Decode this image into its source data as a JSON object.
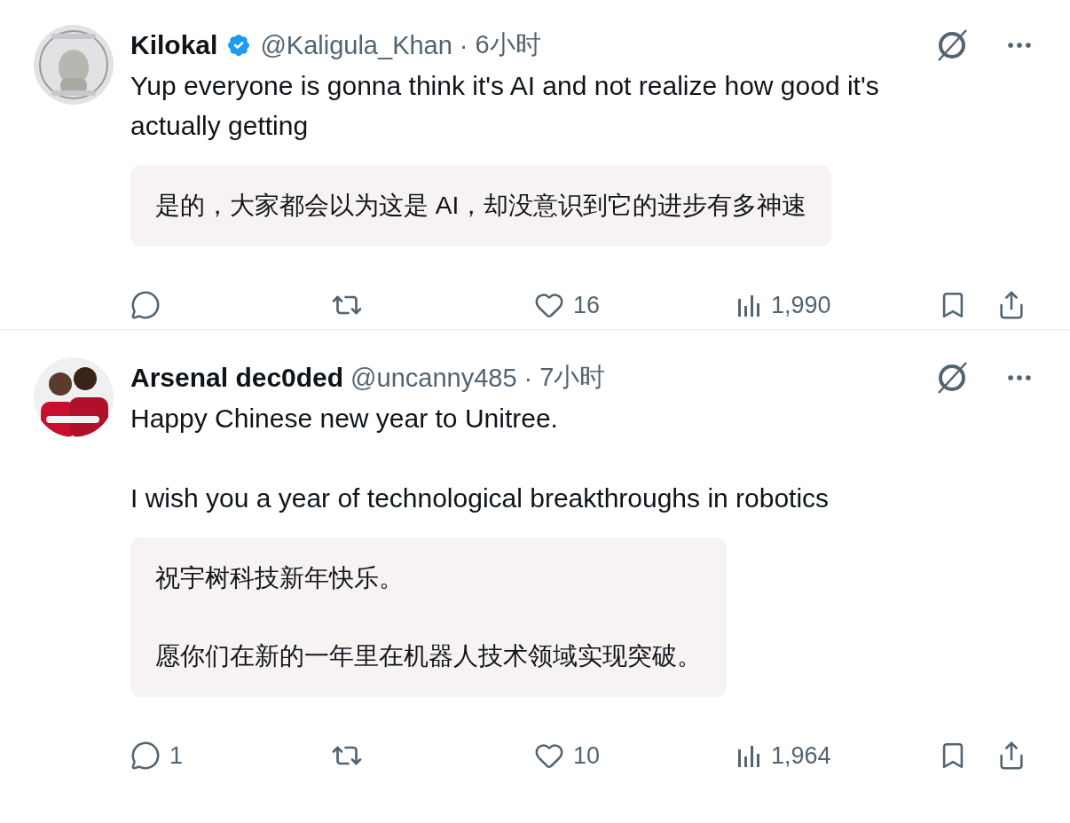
{
  "tweets": [
    {
      "name": "Kilokal",
      "verified": true,
      "handle": "@Kaligula_Khan",
      "separator": "·",
      "time": "6小时",
      "paragraphs": [
        "Yup everyone is gonna think it's AI and not realize how good it's actually getting"
      ],
      "translation": [
        "是的，大家都会以为这是 AI，却没意识到它的进步有多神速"
      ],
      "likes": "16",
      "views": "1,990",
      "avatar": {
        "kind": "picture"
      }
    },
    {
      "name": "Arsenal dec0ded",
      "verified": false,
      "handle": "@uncanny485",
      "separator": "·",
      "time": "7小时",
      "paragraphs": [
        "Happy Chinese new year to Unitree.",
        "I wish you a year of technological breakthroughs in robotics"
      ],
      "translation": [
        "祝宇树科技新年快乐。",
        "愿你们在新的一年里在机器人技术领域实现突破。"
      ],
      "replies": "1",
      "likes": "10",
      "views": "1,964",
      "avatar": {
        "kind": "picture"
      }
    }
  ]
}
